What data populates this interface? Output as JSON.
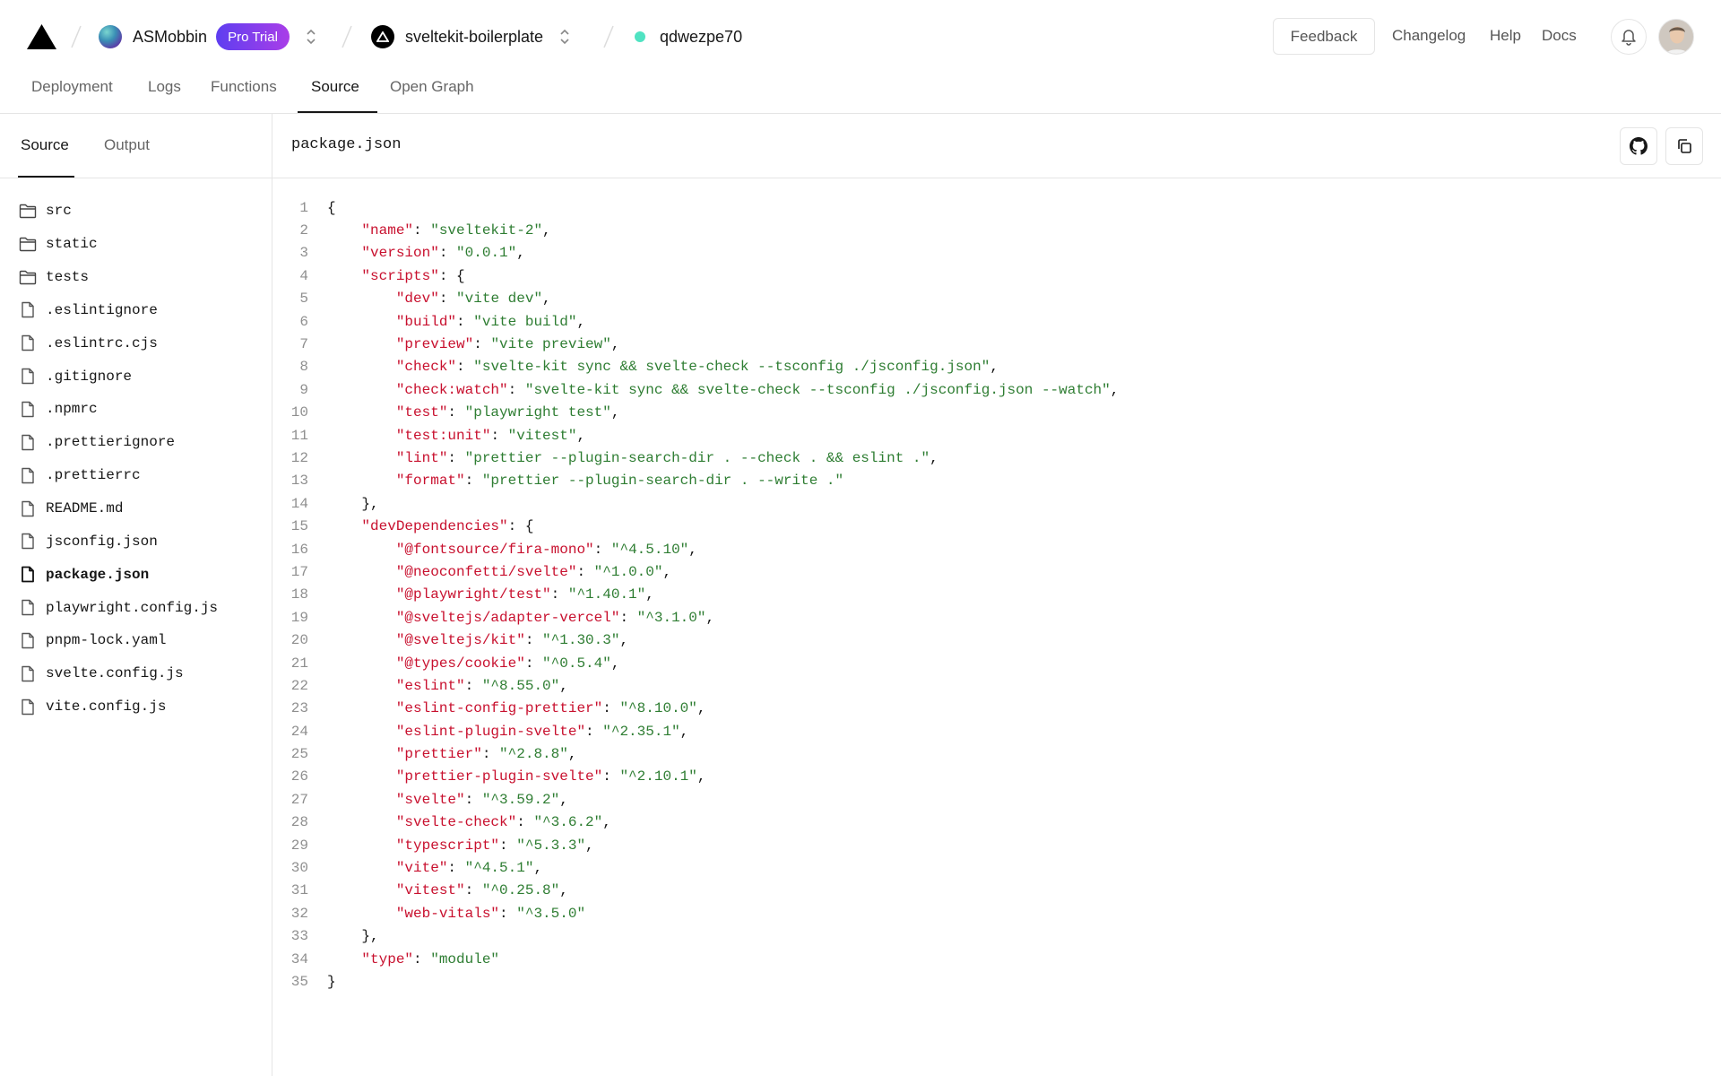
{
  "header": {
    "team_name": "ASMobbin",
    "plan_badge": "Pro Trial",
    "project_name": "sveltekit-boilerplate",
    "deployment_id": "qdwezpe70",
    "feedback_label": "Feedback",
    "links": [
      "Changelog",
      "Help",
      "Docs"
    ],
    "status_color": "#50e3c2"
  },
  "tabs": [
    "Deployment",
    "Logs",
    "Functions",
    "Source",
    "Open Graph"
  ],
  "active_tab": "Source",
  "sidebar": {
    "tabs": [
      "Source",
      "Output"
    ],
    "active_tab": "Source",
    "files": [
      {
        "name": "src",
        "type": "folder"
      },
      {
        "name": "static",
        "type": "folder"
      },
      {
        "name": "tests",
        "type": "folder"
      },
      {
        "name": ".eslintignore",
        "type": "file"
      },
      {
        "name": ".eslintrc.cjs",
        "type": "file"
      },
      {
        "name": ".gitignore",
        "type": "file"
      },
      {
        "name": ".npmrc",
        "type": "file"
      },
      {
        "name": ".prettierignore",
        "type": "file"
      },
      {
        "name": ".prettierrc",
        "type": "file"
      },
      {
        "name": "README.md",
        "type": "file"
      },
      {
        "name": "jsconfig.json",
        "type": "file"
      },
      {
        "name": "package.json",
        "type": "file",
        "active": true
      },
      {
        "name": "playwright.config.js",
        "type": "file"
      },
      {
        "name": "pnpm-lock.yaml",
        "type": "file"
      },
      {
        "name": "svelte.config.js",
        "type": "file"
      },
      {
        "name": "vite.config.js",
        "type": "file"
      }
    ]
  },
  "code_view": {
    "filename": "package.json",
    "lines": [
      "{",
      "    \"name\": \"sveltekit-2\",",
      "    \"version\": \"0.0.1\",",
      "    \"scripts\": {",
      "        \"dev\": \"vite dev\",",
      "        \"build\": \"vite build\",",
      "        \"preview\": \"vite preview\",",
      "        \"check\": \"svelte-kit sync && svelte-check --tsconfig ./jsconfig.json\",",
      "        \"check:watch\": \"svelte-kit sync && svelte-check --tsconfig ./jsconfig.json --watch\",",
      "        \"test\": \"playwright test\",",
      "        \"test:unit\": \"vitest\",",
      "        \"lint\": \"prettier --plugin-search-dir . --check . && eslint .\",",
      "        \"format\": \"prettier --plugin-search-dir . --write .\"",
      "    },",
      "    \"devDependencies\": {",
      "        \"@fontsource/fira-mono\": \"^4.5.10\",",
      "        \"@neoconfetti/svelte\": \"^1.0.0\",",
      "        \"@playwright/test\": \"^1.40.1\",",
      "        \"@sveltejs/adapter-vercel\": \"^3.1.0\",",
      "        \"@sveltejs/kit\": \"^1.30.3\",",
      "        \"@types/cookie\": \"^0.5.4\",",
      "        \"eslint\": \"^8.55.0\",",
      "        \"eslint-config-prettier\": \"^8.10.0\",",
      "        \"eslint-plugin-svelte\": \"^2.35.1\",",
      "        \"prettier\": \"^2.8.8\",",
      "        \"prettier-plugin-svelte\": \"^2.10.1\",",
      "        \"svelte\": \"^3.59.2\",",
      "        \"svelte-check\": \"^3.6.2\",",
      "        \"typescript\": \"^5.3.3\",",
      "        \"vite\": \"^4.5.1\",",
      "        \"vitest\": \"^0.25.8\",",
      "        \"web-vitals\": \"^3.5.0\"",
      "    },",
      "    \"type\": \"module\"",
      "}"
    ]
  },
  "colors": {
    "key": "#c8102e",
    "string": "#2e7d32",
    "badge_gradient": [
      "#5e3ef0",
      "#a93ee8"
    ]
  }
}
